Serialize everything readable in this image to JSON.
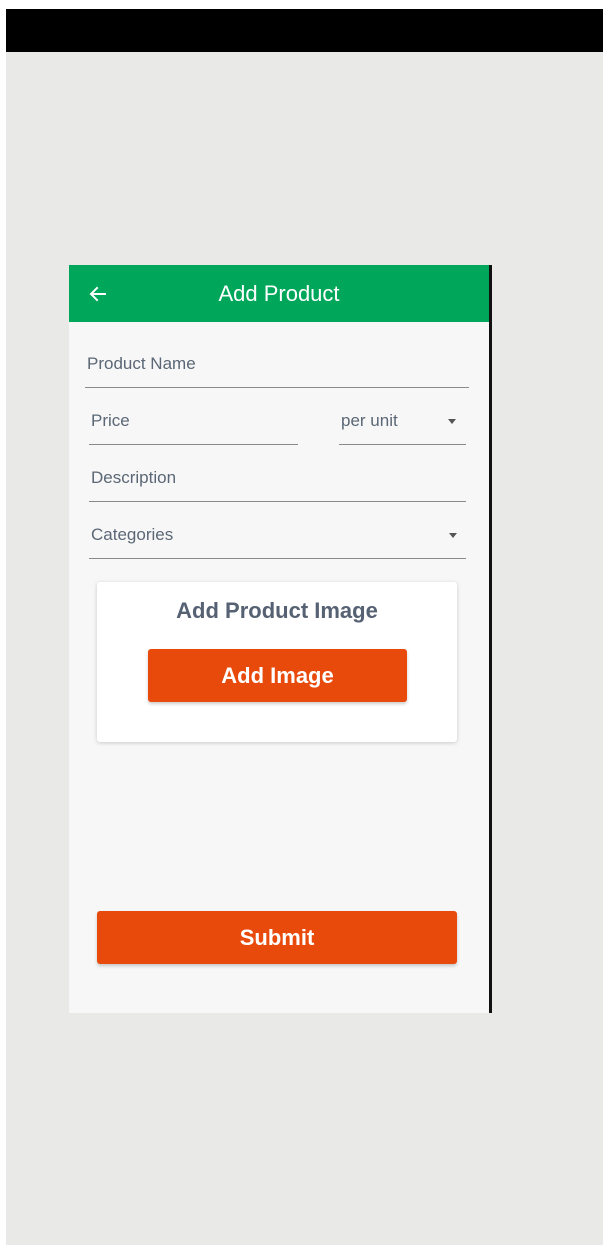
{
  "header": {
    "title": "Add Product",
    "back_icon": "arrow-left-icon",
    "color": "#00a65a"
  },
  "form": {
    "product_name_label": "Product Name",
    "price_label": "Price",
    "unit_select_value": "per unit",
    "description_label": "Description",
    "categories_label": "Categories"
  },
  "image_section": {
    "title": "Add Product Image",
    "button_label": "Add Image"
  },
  "submit_label": "Submit",
  "colors": {
    "accent_button": "#e84a0c",
    "app_bar": "#00a65a"
  }
}
